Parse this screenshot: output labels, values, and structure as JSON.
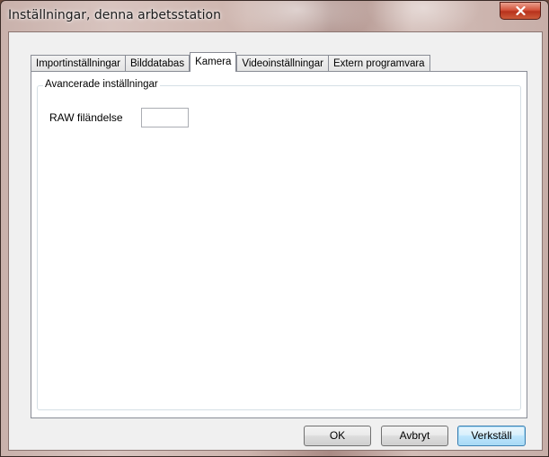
{
  "window": {
    "title": "Inställningar, denna arbetsstation",
    "close_symbol": "close-icon"
  },
  "tabs": [
    {
      "label": "Importinställningar",
      "active": false
    },
    {
      "label": "Bilddatabas",
      "active": false
    },
    {
      "label": "Kamera",
      "active": true
    },
    {
      "label": "Videoinställningar",
      "active": false
    },
    {
      "label": "Extern programvara",
      "active": false
    }
  ],
  "advanced": {
    "group_label": "Avancerade inställningar",
    "raw_extension_label": "RAW filändelse",
    "raw_extension_value": ""
  },
  "buttons": {
    "ok": "OK",
    "cancel": "Avbryt",
    "apply": "Verkställ"
  },
  "colors": {
    "close_button": "#c9452b",
    "dialog_background": "#f0f0f0",
    "default_button_border": "#3c7fb1"
  }
}
